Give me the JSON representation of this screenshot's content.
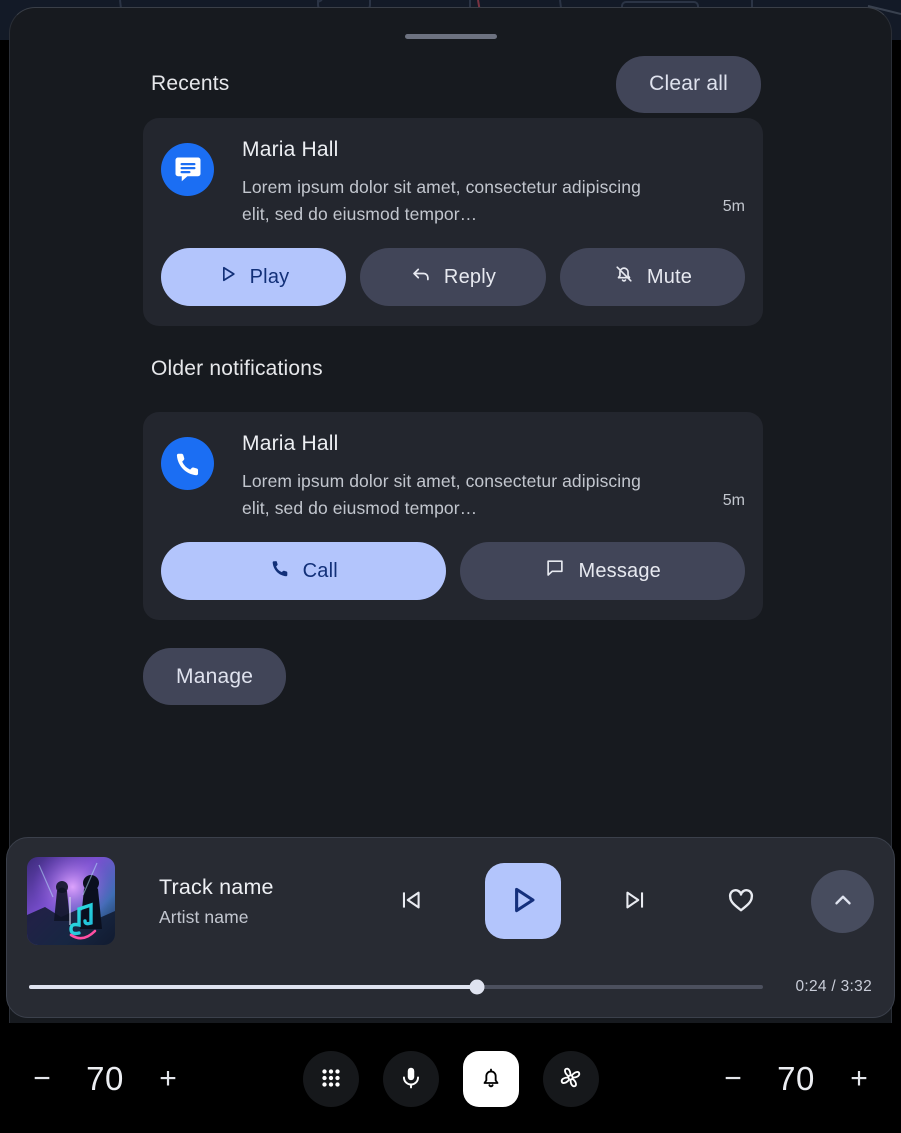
{
  "panel": {
    "drag_handle": "drag-handle"
  },
  "recents": {
    "title": "Recents",
    "clear_all_label": "Clear all"
  },
  "older": {
    "title": "Older notifications"
  },
  "notifications": [
    {
      "icon": "message-app-icon",
      "sender": "Maria Hall",
      "body": "Lorem ipsum dolor sit amet, consectetur adipiscing elit, sed do eiusmod tempor…",
      "time": "5m",
      "actions": [
        {
          "label": "Play",
          "icon": "play-icon",
          "style": "primary"
        },
        {
          "label": "Reply",
          "icon": "reply-icon",
          "style": "secondary"
        },
        {
          "label": "Mute",
          "icon": "bell-off-icon",
          "style": "secondary"
        }
      ]
    },
    {
      "icon": "phone-app-icon",
      "sender": "Maria Hall",
      "body": "Lorem ipsum dolor sit amet, consectetur adipiscing elit, sed do eiusmod tempor…",
      "time": "5m",
      "actions": [
        {
          "label": "Call",
          "icon": "phone-icon",
          "style": "primary"
        },
        {
          "label": "Message",
          "icon": "message-icon",
          "style": "secondary"
        }
      ]
    }
  ],
  "manage": {
    "label": "Manage"
  },
  "media": {
    "album_art": "concert-album-art",
    "track_name": "Track name",
    "artist_name": "Artist name",
    "controls": {
      "previous": "skip-previous-icon",
      "play": "play-icon",
      "next": "skip-next-icon",
      "favorite": "heart-icon",
      "expand": "chevron-up-icon"
    },
    "progress": {
      "elapsed": "0:24",
      "duration": "3:32",
      "time_label": "0:24 / 3:32",
      "percent": 61
    }
  },
  "bottom_bar": {
    "left_volume": {
      "minus_label": "−",
      "value": "70",
      "plus_label": "+"
    },
    "right_volume": {
      "minus_label": "−",
      "value": "70",
      "plus_label": "+"
    },
    "buttons": [
      {
        "icon": "apps-grid-icon",
        "active": false
      },
      {
        "icon": "microphone-icon",
        "active": false
      },
      {
        "icon": "bell-icon",
        "active": true
      },
      {
        "icon": "fan-icon",
        "active": false
      }
    ]
  },
  "colors": {
    "accent": "#b3c5fc",
    "accent_text": "#123078",
    "card_bg": "#23262e",
    "secondary_btn": "#414558",
    "panel_bg": "#171a1f",
    "avatar_blue": "#1b6ef3"
  }
}
